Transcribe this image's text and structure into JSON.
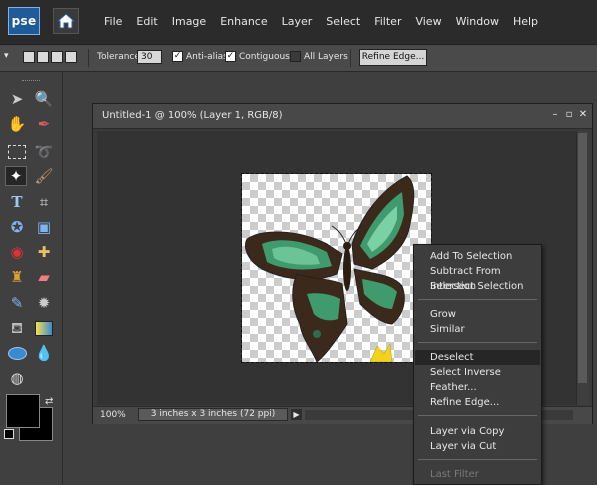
{
  "app": {
    "logo_text": "pse"
  },
  "menubar": {
    "items": [
      "File",
      "Edit",
      "Image",
      "Enhance",
      "Layer",
      "Select",
      "Filter",
      "View",
      "Window",
      "Help"
    ]
  },
  "options_bar": {
    "tolerance_label": "Tolerance:",
    "tolerance_value": "30",
    "anti_alias_label": "Anti-alias",
    "anti_alias_checked": true,
    "contiguous_label": "Contiguous",
    "contiguous_checked": true,
    "all_layers_label": "All Layers",
    "all_layers_checked": false,
    "refine_edge_label": "Refine Edge..."
  },
  "document": {
    "title": "Untitled-1 @ 100% (Layer 1, RGB/8)",
    "zoom": "100%",
    "info": "3 inches x 3 inches (72 ppi)"
  },
  "context_menu": {
    "groups": [
      [
        "Add To Selection",
        "Subtract From Selection",
        "Intersect Selection"
      ],
      [
        "Grow",
        "Similar"
      ],
      [
        "Deselect",
        "Select Inverse",
        "Feather...",
        "Refine Edge..."
      ],
      [
        "Layer via Copy",
        "Layer via Cut"
      ],
      [
        "Last Filter"
      ]
    ],
    "highlighted": "Deselect",
    "disabled": [
      "Last Filter"
    ]
  },
  "colors": {
    "foreground": "#000000",
    "background": "#000000",
    "accent": "#1f5a99"
  },
  "icons": [
    "home-icon",
    "move-icon",
    "zoom-icon",
    "hand-icon",
    "eyedropper-icon",
    "marquee-icon",
    "lasso-icon",
    "magic-wand-icon",
    "brush-selection-icon",
    "type-icon",
    "crop-icon",
    "cookie-cutter-icon",
    "recompose-icon",
    "red-eye-icon",
    "healing-brush-icon",
    "clone-stamp-icon",
    "eraser-icon",
    "brush-icon",
    "smart-brush-icon",
    "paint-bucket-icon",
    "gradient-icon",
    "shape-icon",
    "blur-icon",
    "sponge-icon",
    "swap-colors-icon"
  ]
}
